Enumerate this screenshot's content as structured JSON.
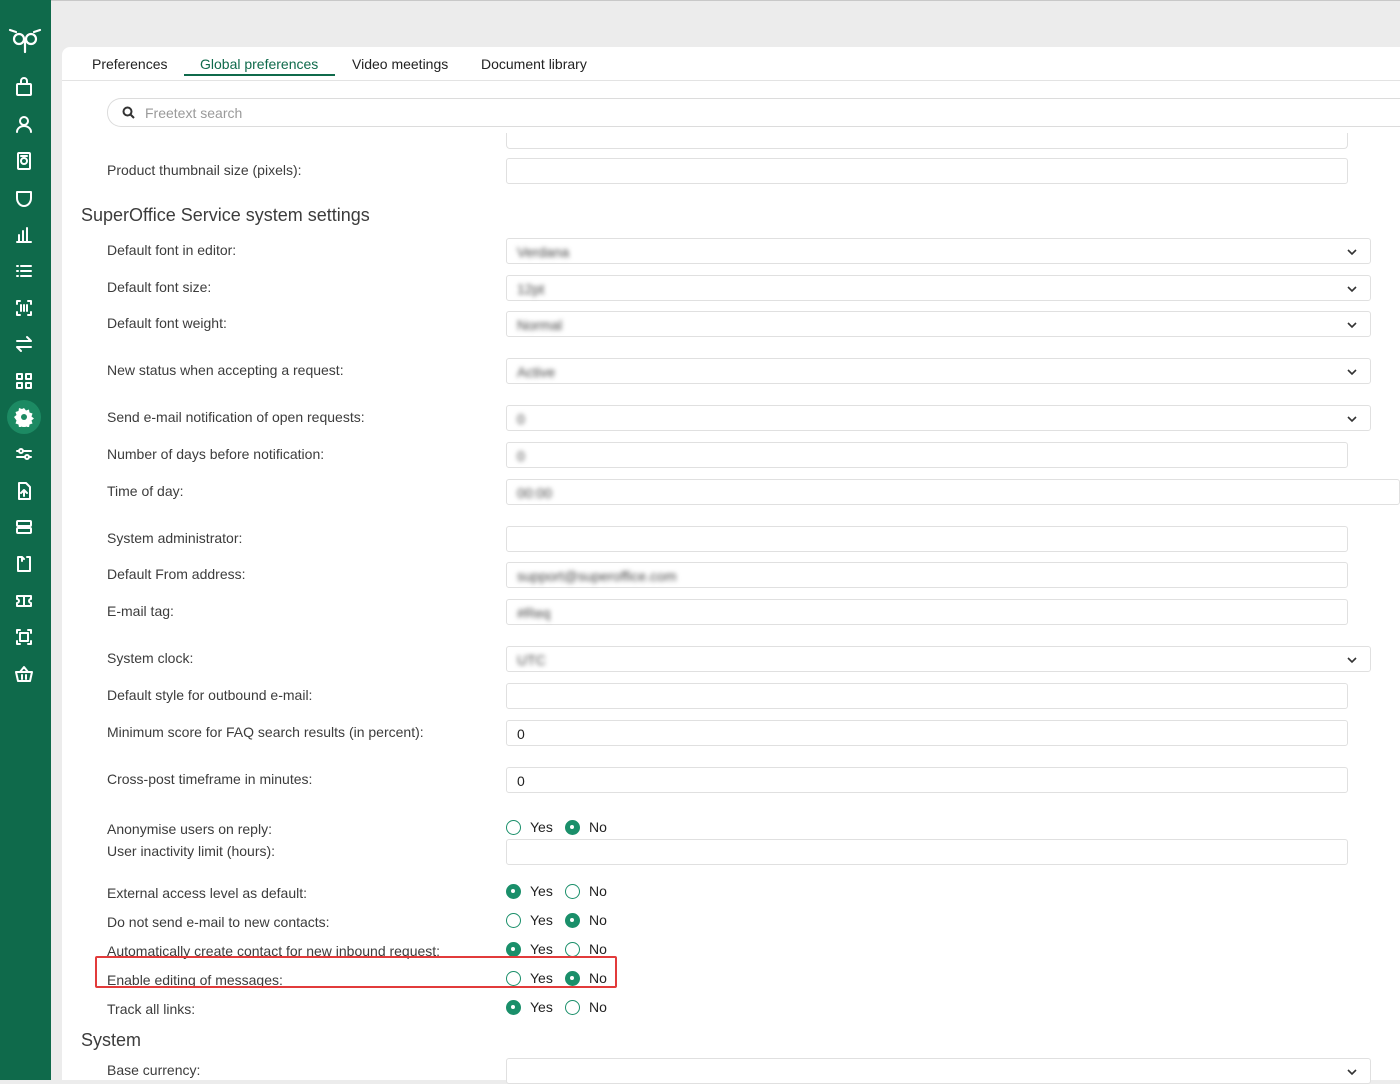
{
  "tabs": [
    "Preferences",
    "Global preferences",
    "Video meetings",
    "Document library"
  ],
  "search": {
    "placeholder": "Freetext search"
  },
  "top_row": {
    "label": "Product thumbnail size (pixels):",
    "value": ""
  },
  "sections": {
    "service": "SuperOffice Service system settings",
    "system": "System"
  },
  "service_settings": [
    {
      "label": "Default font in editor:",
      "value": "Verdana",
      "type": "select",
      "blurred": true
    },
    {
      "label": "Default font size:",
      "value": "12pt",
      "type": "select",
      "blurred": true
    },
    {
      "label": "Default font weight:",
      "value": "Normal",
      "type": "select",
      "blurred": true
    },
    {
      "label": "New status when accepting a request:",
      "value": "Active",
      "type": "select",
      "blurred": true
    },
    {
      "label": "Send e-mail notification of open requests:",
      "value": "0",
      "type": "select",
      "blurred": true
    },
    {
      "label": "Number of days before notification:",
      "value": "0",
      "type": "text",
      "blurred": true
    },
    {
      "label": "Time of day:",
      "value": "00:00",
      "type": "text",
      "blurred": true
    },
    {
      "label": "System administrator:",
      "value": "",
      "type": "text",
      "blurred": false
    },
    {
      "label": "Default From address:",
      "value": "support@superoffice.com",
      "type": "text",
      "blurred": true
    },
    {
      "label": "E-mail tag:",
      "value": "#Req",
      "type": "text",
      "blurred": true
    },
    {
      "label": "System clock:",
      "value": "UTC",
      "type": "select",
      "blurred": true
    },
    {
      "label": "Default style for outbound e-mail:",
      "value": "",
      "type": "text",
      "blurred": false
    },
    {
      "label": "Minimum score for FAQ search results (in percent):",
      "value": "0",
      "type": "text",
      "blurred": false
    },
    {
      "label": "Cross-post timeframe in minutes:",
      "value": "0",
      "type": "text",
      "blurred": false
    }
  ],
  "radio_options": {
    "yes": "Yes",
    "no": "No"
  },
  "radio_settings": [
    {
      "label": "Anonymise users on reply:",
      "selected": "No"
    },
    {
      "label": "External access level as default:",
      "selected": "Yes"
    },
    {
      "label": "Do not send e-mail to new contacts:",
      "selected": "No"
    },
    {
      "label": "Automatically create contact for new inbound request:",
      "selected": "Yes"
    },
    {
      "label": "Enable editing of messages:",
      "selected": "No",
      "highlighted": true
    },
    {
      "label": "Track all links:",
      "selected": "Yes"
    }
  ],
  "inactivity": {
    "label": "User inactivity limit (hours):",
    "value": ""
  },
  "system_settings": [
    {
      "label": "Base currency:",
      "value": "",
      "type": "select"
    }
  ],
  "sidebar_icons": [
    "logo-owl-icon",
    "sales-icon",
    "contacts-icon",
    "projects-icon",
    "service-icon",
    "dashboard-icon",
    "selections-icon",
    "marketing-icon",
    "sync-icon",
    "apps-icon",
    "settings-icon",
    "preferences-icon",
    "import-icon",
    "lists-icon",
    "requests-icon",
    "tickets-icon",
    "screens-icon",
    "basket-icon"
  ],
  "colors": {
    "sidebar": "#0f6a4b",
    "accent": "#1a8f6a",
    "highlight": "#e23b3b"
  }
}
